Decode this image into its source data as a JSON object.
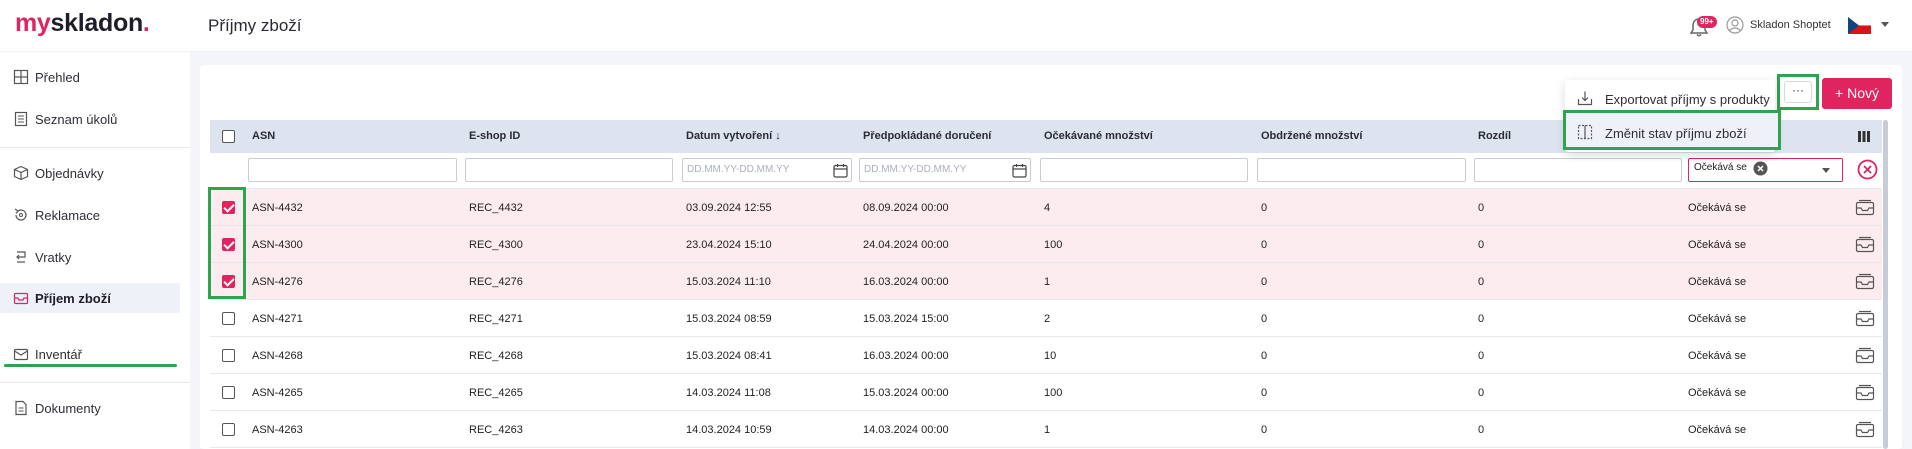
{
  "brand": {
    "logo_my": "my",
    "logo_skladon": "skladon",
    "logo_dot": "."
  },
  "header": {
    "title": "Příjmy zboží",
    "notification_badge": "99+",
    "user_name": "Skladon Shoptet"
  },
  "sidebar": {
    "items": [
      {
        "label": "Přehled",
        "icon": "dashboard-icon"
      },
      {
        "label": "Seznam úkolů",
        "icon": "tasks-icon"
      },
      {
        "label": "Objednávky",
        "icon": "box-icon"
      },
      {
        "label": "Reklamace",
        "icon": "return-icon"
      },
      {
        "label": "Vratky",
        "icon": "returns-icon"
      },
      {
        "label": "Příjem zboží",
        "icon": "receiving-icon"
      },
      {
        "label": "Inventář",
        "icon": "inventory-icon"
      },
      {
        "label": "Dokumenty",
        "icon": "document-icon"
      }
    ]
  },
  "toolbar": {
    "more_label": "···",
    "new_label": "+ Nový"
  },
  "dropdown": {
    "items": [
      {
        "label": "Exportovat příjmy s produkty",
        "icon": "export-icon"
      },
      {
        "label": "Změnit stav příjmu zboží",
        "icon": "columns-icon"
      }
    ]
  },
  "table": {
    "columns": [
      "ASN",
      "E-shop ID",
      "Datum vytvoření ↓",
      "Předpokládané doručení",
      "Očekávané množství",
      "Obdržené množství",
      "Rozdíl"
    ],
    "filters": {
      "date_placeholder": "DD.MM.YY-DD.MM.YY",
      "status_value": "Očekává se"
    },
    "rows": [
      {
        "selected": true,
        "asn": "ASN-4432",
        "eshop": "REC_4432",
        "created": "03.09.2024 12:55",
        "delivery": "08.09.2024 00:00",
        "expected": "4",
        "received": "0",
        "diff": "0",
        "status": "Očekává se"
      },
      {
        "selected": true,
        "asn": "ASN-4300",
        "eshop": "REC_4300",
        "created": "23.04.2024 15:10",
        "delivery": "24.04.2024 00:00",
        "expected": "100",
        "received": "0",
        "diff": "0",
        "status": "Očekává se"
      },
      {
        "selected": true,
        "asn": "ASN-4276",
        "eshop": "REC_4276",
        "created": "15.03.2024 11:10",
        "delivery": "16.03.2024 00:00",
        "expected": "1",
        "received": "0",
        "diff": "0",
        "status": "Očekává se"
      },
      {
        "selected": false,
        "asn": "ASN-4271",
        "eshop": "REC_4271",
        "created": "15.03.2024 08:59",
        "delivery": "15.03.2024 15:00",
        "expected": "2",
        "received": "0",
        "diff": "0",
        "status": "Očekává se"
      },
      {
        "selected": false,
        "asn": "ASN-4268",
        "eshop": "REC_4268",
        "created": "15.03.2024 08:41",
        "delivery": "16.03.2024 00:00",
        "expected": "10",
        "received": "0",
        "diff": "0",
        "status": "Očekává se"
      },
      {
        "selected": false,
        "asn": "ASN-4265",
        "eshop": "REC_4265",
        "created": "14.03.2024 11:08",
        "delivery": "15.03.2024 00:00",
        "expected": "100",
        "received": "0",
        "diff": "0",
        "status": "Očekává se"
      },
      {
        "selected": false,
        "asn": "ASN-4263",
        "eshop": "REC_4263",
        "created": "14.03.2024 10:59",
        "delivery": "14.03.2024 00:00",
        "expected": "1",
        "received": "0",
        "diff": "0",
        "status": "Očekává se"
      }
    ]
  },
  "colors": {
    "accent": "#e0245e",
    "highlight": "#2fa44f",
    "header_bg": "#dde3ef"
  }
}
